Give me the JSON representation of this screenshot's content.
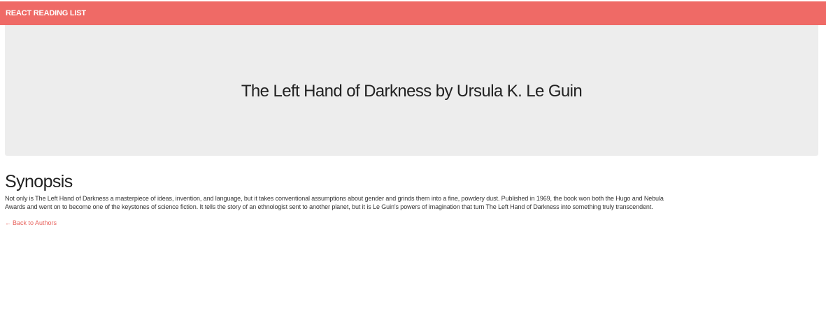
{
  "header": {
    "brand": "REACT READING LIST",
    "color": "#ef6a66"
  },
  "hero": {
    "title": "The Left Hand of Darkness by Ursula K. Le Guin",
    "background": "#ededed"
  },
  "synopsis": {
    "heading": "Synopsis",
    "body": "Not only is The Left Hand of Darkness a masterpiece of ideas, invention, and language, but it takes conventional assumptions about gender and grinds them into a fine, powdery dust. Published in 1969, the book won both the Hugo and Nebula Awards and went on to become one of the keystones of science fiction. It tells the story of an ethnologist sent to another planet, but it is Le Guin's powers of imagination that turn The Left Hand of Darkness into something truly transcendent."
  },
  "back_link": {
    "icon": "arrow-left-icon",
    "arrow": "←",
    "label": "Back to Authors"
  }
}
